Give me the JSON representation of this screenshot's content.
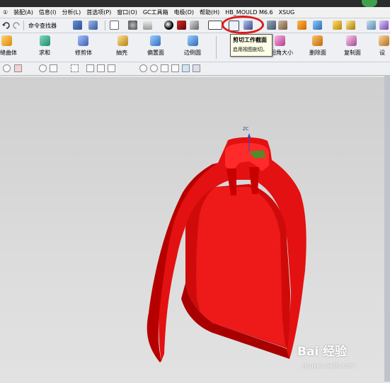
{
  "menu": {
    "items": [
      "①",
      "装配(A)",
      "信息(I)",
      "分析(L)",
      "首选项(P)",
      "窗口(O)",
      "GC工具箱",
      "电极(D)",
      "帮助(H)",
      "HB_MOULD M6.6",
      "XSUG"
    ]
  },
  "toolbar1": {
    "command_finder": "命令查找器"
  },
  "toolbar2": {
    "buttons": [
      "缝曲体",
      "求和",
      "修剪体",
      "抽壳",
      "偏置面",
      "边倒圆",
      "图角大小",
      "删除面",
      "复制面",
      "设"
    ]
  },
  "tooltip": {
    "title": "剪切工作截面",
    "description": "启用视图剖切。"
  },
  "viewport": {
    "axis_label": "ZC"
  },
  "watermark": {
    "text": "Bai 经验",
    "url": "jingyan.baidu.com"
  },
  "colors": {
    "model": "#e41010",
    "highlight": "#e01b1b",
    "tooltip_bg": "#ffffe8"
  }
}
